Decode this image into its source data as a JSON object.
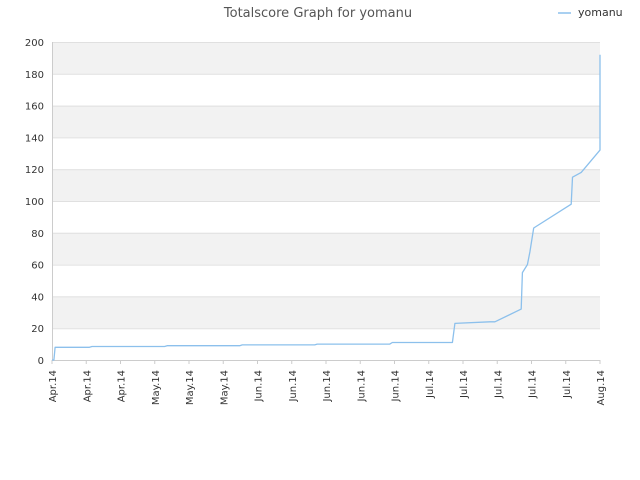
{
  "chart_data": {
    "type": "line",
    "title": "Totalscore Graph for yomanu",
    "xlabel": "",
    "ylabel": "",
    "ylim": [
      0,
      200
    ],
    "yticks": [
      0,
      20,
      40,
      60,
      80,
      100,
      120,
      140,
      160,
      180,
      200
    ],
    "xticks": [
      "Apr.14",
      "Apr.14",
      "Apr.14",
      "May.14",
      "May.14",
      "May.14",
      "Jun.14",
      "Jun.14",
      "Jun.14",
      "Jun.14",
      "Jun.14",
      "Jul.14",
      "Jul.14",
      "Jul.14",
      "Jul.14",
      "Jul.14",
      "Aug.14"
    ],
    "grid": "horizontal bands",
    "legend": "top-right",
    "colors": {
      "series": "#8cc0ec",
      "band": "#f2f2f2",
      "gridline": "#e0e0e0",
      "axis": "#cccccc"
    },
    "series": [
      {
        "name": "yomanu",
        "x": [
          0.0,
          0.15,
          0.25,
          3.0,
          3.2,
          9.0,
          9.2,
          15.0,
          15.2,
          21.0,
          21.2,
          27.0,
          27.2,
          32.0,
          32.2,
          35.0,
          35.4,
          37.5,
          37.6,
          38.0,
          38.2,
          38.5,
          41.5,
          41.6,
          42.3,
          43.8,
          43.8
        ],
        "values": [
          0,
          0,
          8,
          8,
          8.5,
          8.5,
          9,
          9,
          9.5,
          9.5,
          10,
          10,
          11,
          11,
          23,
          24,
          24,
          32,
          55,
          60,
          68,
          83,
          98,
          115,
          118,
          132,
          192
        ]
      }
    ]
  }
}
